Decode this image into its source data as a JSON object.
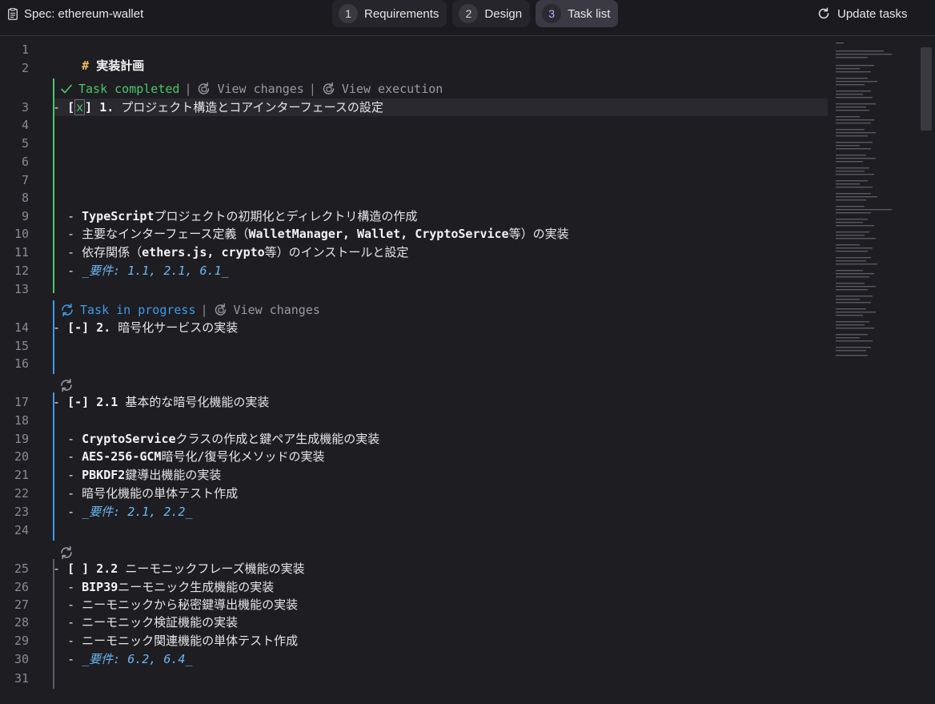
{
  "header": {
    "spec_title": "Spec: ethereum-wallet",
    "tabs": [
      {
        "num": "1",
        "label": "Requirements"
      },
      {
        "num": "2",
        "label": "Design"
      },
      {
        "num": "3",
        "label": "Task list"
      }
    ],
    "update_label": "Update tasks"
  },
  "gutter": [
    "1",
    "2",
    "3",
    "4",
    "5",
    "6",
    "7",
    "8",
    "9",
    "10",
    "11",
    "12",
    "13",
    "14",
    "15",
    "16",
    "17",
    "18",
    "19",
    "20",
    "21",
    "22",
    "23",
    "24",
    "25",
    "26",
    "27",
    "28",
    "29",
    "30",
    "31"
  ],
  "lens": {
    "task1_status": "Task completed",
    "view_changes": "View changes",
    "view_execution": "View execution",
    "task2_status": "Task in progress",
    "sep": "|"
  },
  "lines": {
    "l1_hash": "#",
    "l1_text": "実装計画",
    "l3_prefix": "- ",
    "l3_check_open": "[",
    "l3_check_mark": "x",
    "l3_check_close": "]",
    "l3_num": "1.",
    "l3_text": "プロジェクト構造とコアインターフェースの設定",
    "l9_dash": "- ",
    "l9_bold": "TypeScript",
    "l9_text": "プロジェクトの初期化とディレクトリ構造の作成",
    "l10_dash": "- ",
    "l10_pre": "主要なインターフェース定義（",
    "l10_bold": "WalletManager, Wallet, CryptoService",
    "l10_post": "等）の実装",
    "l11_dash": "- ",
    "l11_pre": "依存関係（",
    "l11_bold": "ethers.js, crypto",
    "l11_post": "等）のインストールと設定",
    "l12_dash": "- ",
    "l12_em": "_要件: 1.1, 2.1, 6.1_",
    "l14_prefix": "- ",
    "l14_check": "[-]",
    "l14_num": "2.",
    "l14_text": "暗号化サービスの実装",
    "l17_prefix": "- ",
    "l17_check": "[-]",
    "l17_num": "2.1",
    "l17_text": "基本的な暗号化機能の実装",
    "l19_dash": "- ",
    "l19_bold": "CryptoService",
    "l19_text": "クラスの作成と鍵ペア生成機能の実装",
    "l20_dash": "- ",
    "l20_bold": "AES-256-GCM",
    "l20_text": "暗号化/復号化メソッドの実装",
    "l21_dash": "- ",
    "l21_bold": "PBKDF2",
    "l21_text": "鍵導出機能の実装",
    "l22_dash": "- ",
    "l22_text": "暗号化機能の単体テスト作成",
    "l23_dash": "- ",
    "l23_em": "_要件: 2.1, 2.2_",
    "l25_prefix": "- ",
    "l25_check": "[ ]",
    "l25_num": "2.2",
    "l25_text": "ニーモニックフレーズ機能の実装",
    "l26_dash": "- ",
    "l26_bold": "BIP39",
    "l26_text": "ニーモニック生成機能の実装",
    "l27_dash": "- ",
    "l27_text": "ニーモニックから秘密鍵導出機能の実装",
    "l28_dash": "- ",
    "l28_text": "ニーモニック検証機能の実装",
    "l29_dash": "- ",
    "l29_text": "ニーモニック関連機能の単体テスト作成",
    "l30_dash": "- ",
    "l30_em": "_要件: 6.2, 6.4_"
  },
  "colors": {
    "accent": "#c6a8ff",
    "completed": "#4cc76a",
    "in_progress": "#3d9be9",
    "heading": "#f0b85a",
    "emphasis": "#6ab7f0"
  },
  "icons": [
    "document-icon",
    "refresh-icon",
    "check-icon",
    "sync-icon",
    "view-changes-icon",
    "view-execution-icon"
  ]
}
